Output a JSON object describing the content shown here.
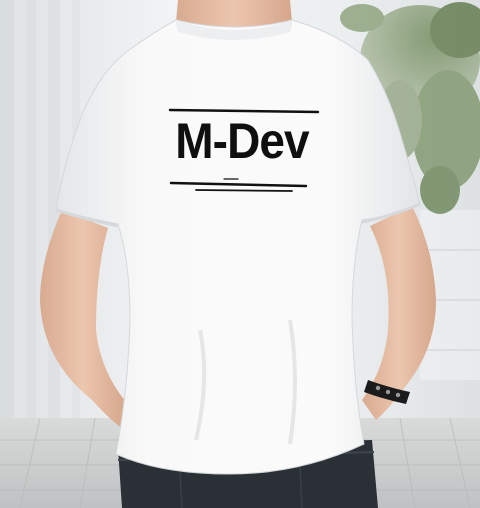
{
  "photo": {
    "subject": "person-back-white-tshirt",
    "print_text": "M-Dev",
    "colors": {
      "shirt": "#f7f7f7",
      "print": "#0f0f0f",
      "jeans": "#2b3036",
      "skin": "#e2b9a0",
      "wall": "#eef0f1",
      "floor": "#cfd1d1",
      "plant": "#4f6a3f"
    }
  }
}
